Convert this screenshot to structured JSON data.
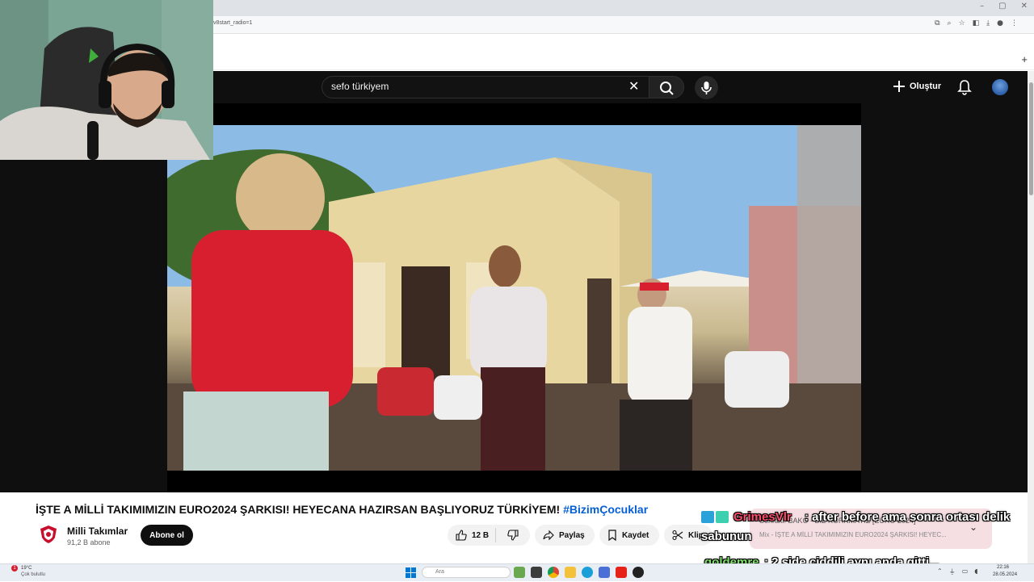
{
  "browser": {
    "url": "v8start_radio=1",
    "window_controls": [
      "–",
      "▢",
      "✕"
    ],
    "new_tab_symbol": "+"
  },
  "youtube": {
    "search": {
      "query": "sefo türkiyem"
    },
    "create_label": "Oluştur"
  },
  "video": {
    "title_main": "İŞTE A MİLLİ TAKIMIMIZIN EURO2024 ŞARKISI! HEYECANA HAZIRSAN BAŞLIYORUZ TÜRKİYEM!",
    "title_hashtag": "#BizimÇocuklar",
    "channel_name": "Milli Takımlar",
    "subscriber_count": "91,2 B abone",
    "subscribe_label": "Abone ol",
    "likes": "12 B",
    "share_label": "Paylaş",
    "save_label": "Kaydet",
    "clip_label": "Klip"
  },
  "up_next": {
    "line1": "Sonraki: BAKO - BİZ KORKMAYIZ [EURO 2024]",
    "line2": "Mix - İŞTE A MİLLİ TAKIMIMIZIN EURO2024 ŞARKISI! HEYEC..."
  },
  "chat": {
    "msg1_user": "GrimesVlr",
    "msg1_text": ": after before ama sonra ortası delik",
    "msg1_cont": "sabunun",
    "msg2_user": "goldemre",
    "msg2_text": ": 2 side ciddili aynı anda gitti..."
  },
  "taskbar": {
    "weather_badge": "1",
    "weather_temp": "19°C",
    "weather_desc": "Çok bulutlu",
    "search_placeholder": "Ara",
    "clock_time": "22:16",
    "clock_date": "28.05.2024"
  },
  "colors": {
    "youtube_dark": "#0f0f0f",
    "hashtag_blue": "#065fd4",
    "chat_user1": "#ff4d6d",
    "chat_user2": "#7ee06a"
  }
}
